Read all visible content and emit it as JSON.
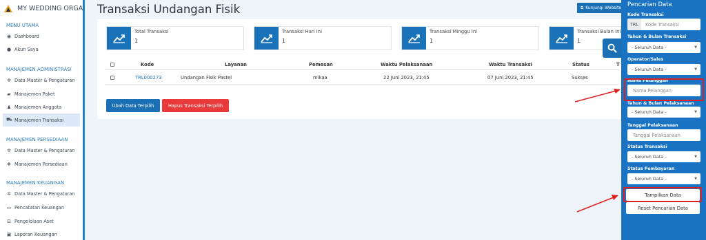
{
  "brand": {
    "name": "MY WEDDING ORGAN"
  },
  "sidebar": {
    "sections": [
      {
        "title": "MENU UTAMA",
        "items": [
          {
            "label": "Dashboard",
            "icon": "dashboard-icon"
          },
          {
            "label": "Akun Saya",
            "icon": "user-icon"
          }
        ]
      },
      {
        "title": "MANAJEMEN ADMINISTRASI",
        "items": [
          {
            "label": "Data Master & Pengaturan",
            "icon": "cogs-icon"
          },
          {
            "label": "Manajemen Paket",
            "icon": "book-icon"
          },
          {
            "label": "Manajemen Anggota",
            "icon": "users-icon"
          },
          {
            "label": "Manajemen Transaksi",
            "icon": "cart-icon",
            "active": true
          }
        ]
      },
      {
        "title": "MANAJEMEN PERSEDIAAN",
        "items": [
          {
            "label": "Data Master & Pengaturan",
            "icon": "cogs-icon"
          },
          {
            "label": "Manajemen Persediaan",
            "icon": "cubes-icon"
          }
        ]
      },
      {
        "title": "MANAJEMEN KEUANGAN",
        "items": [
          {
            "label": "Data Master & Pengaturan",
            "icon": "cogs-icon"
          },
          {
            "label": "Pencatatan Keuangan",
            "icon": "money-icon"
          },
          {
            "label": "Pengelolaan Aset",
            "icon": "drive-icon"
          },
          {
            "label": "Laporan Keuangan",
            "icon": "report-icon"
          }
        ]
      }
    ]
  },
  "header": {
    "title": "Transaksi Undangan Fisik",
    "visit_button": "Kunjungi Website"
  },
  "stats": [
    {
      "label": "Total Transaksi",
      "value": "1"
    },
    {
      "label": "Transaksi Hari Ini",
      "value": "1"
    },
    {
      "label": "Transaksi Minggu Ini",
      "value": "1"
    },
    {
      "label": "Transaksi Bulan Ini",
      "value": "1"
    }
  ],
  "table": {
    "headers": [
      "Kode",
      "Layanan",
      "Pemesan",
      "Waktu Pelaksanaan",
      "Waktu Transaksi",
      "Status",
      "T"
    ],
    "rows": [
      {
        "kode": "TRL000273",
        "layanan": "Undangan Fisik Pastel",
        "pemesan": "mikaa",
        "waktu_pelaksanaan": "22 Juni 2023, 21:45",
        "waktu_transaksi": "07 Juni 2023, 21:45",
        "status": "Sukses"
      }
    ]
  },
  "actions": {
    "update": "Ubah Data Terpilih",
    "delete": "Hapus Transaksi Terpilih"
  },
  "filter": {
    "title": "Pencarian Data",
    "kode_label": "Kode Transaksi",
    "kode_prefix": "TRL",
    "kode_placeholder": "Kode Transaksi",
    "tahun_bulan_transaksi_label": "Tahun & Bulan Transaksi",
    "tahun_bulan_transaksi_value": "- Seluruh Data -",
    "operator_label": "Operator/Sales",
    "operator_value": "- Seluruh Data -",
    "nama_label": "Nama Pelanggan",
    "nama_placeholder": "Nama Pelanggan",
    "tahun_bulan_pelaksanaan_label": "Tahun & Bulan Pelaksanaan",
    "tahun_bulan_pelaksanaan_value": "- Seluruh Data -",
    "tanggal_label": "Tanggal Pelaksanaan",
    "tanggal_placeholder": "Tanggal Pelaksanaan",
    "status_transaksi_label": "Status Transaksi",
    "status_transaksi_value": "- Seluruh Data -",
    "status_pembayaran_label": "Status Pembayaran",
    "status_pembayaran_value": "- Seluruh Data -",
    "submit": "Tampilkan Data",
    "reset": "Reset Pencarian Data"
  },
  "colors": {
    "primary": "#1a73c2",
    "danger": "#e83a3a",
    "annotation": "#e02020"
  }
}
